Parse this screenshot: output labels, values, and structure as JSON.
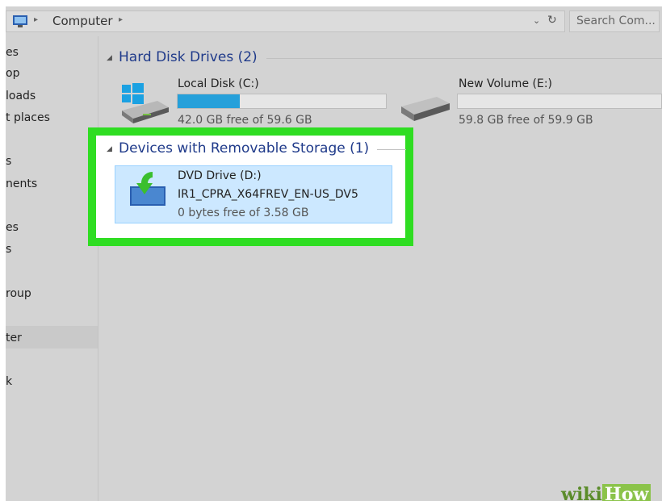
{
  "address_bar": {
    "breadcrumb_root": "Computer",
    "search_placeholder": "Search Com..."
  },
  "nav_pane": {
    "items": [
      "es",
      "op",
      "loads",
      "t places",
      "s",
      "nents",
      "es",
      "s",
      "roup",
      "ter",
      "k"
    ],
    "selected_index": 9
  },
  "groups": [
    {
      "title": "Hard Disk Drives (2)"
    },
    {
      "title": "Devices with Removable Storage (1)"
    }
  ],
  "drives": [
    {
      "name": "Local Disk (C:)",
      "free_text": "42.0 GB free of 59.6 GB",
      "used_fraction": 0.3
    },
    {
      "name": "New Volume (E:)",
      "free_text": "59.8 GB free of 59.9 GB",
      "used_fraction": 0.0
    }
  ],
  "dvd": {
    "name": "DVD Drive (D:)",
    "label": "IR1_CPRA_X64FREV_EN-US_DV5",
    "free_text": "0 bytes free of 3.58 GB"
  },
  "watermark": {
    "part1": "wiki",
    "part2": "How"
  },
  "colors": {
    "highlight": "#2fdd22",
    "bar_fill": "#26a0da",
    "group_header": "#1f3a8a",
    "selection": "#cce8ff"
  }
}
